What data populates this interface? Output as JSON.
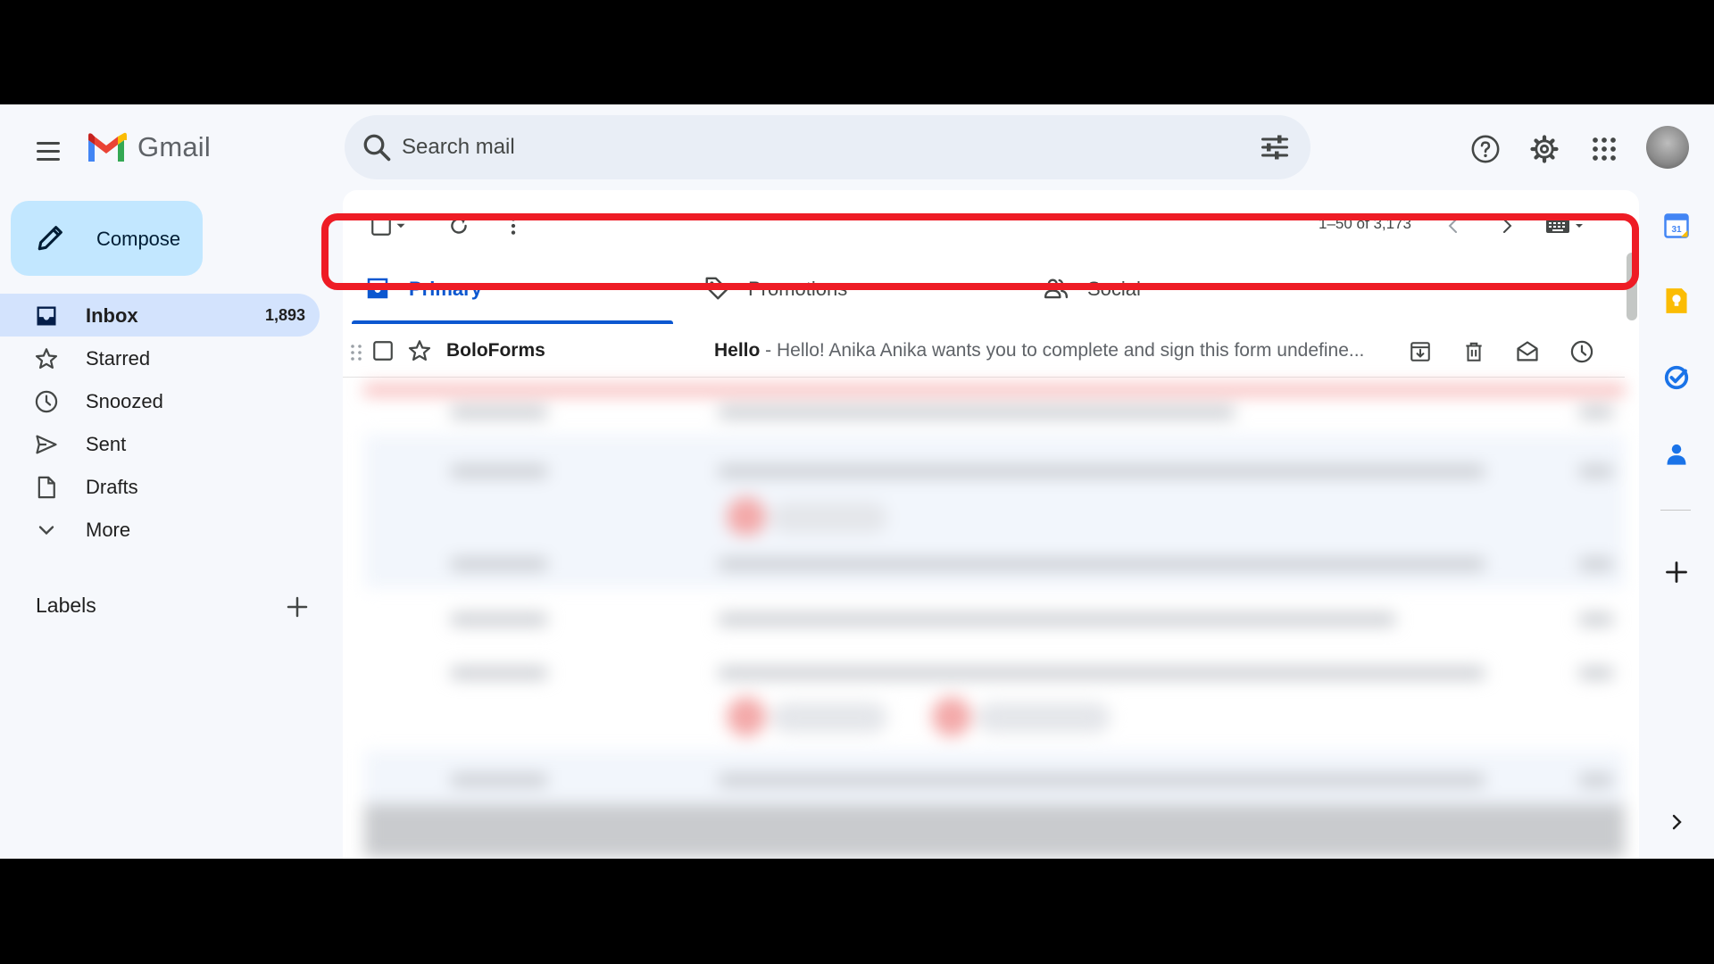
{
  "app": {
    "name": "Gmail"
  },
  "search": {
    "placeholder": "Search mail"
  },
  "compose": {
    "label": "Compose"
  },
  "nav": {
    "items": [
      {
        "label": "Inbox",
        "count": "1,893",
        "icon": "inbox-icon"
      },
      {
        "label": "Starred",
        "count": "",
        "icon": "star-icon"
      },
      {
        "label": "Snoozed",
        "count": "",
        "icon": "clock-icon"
      },
      {
        "label": "Sent",
        "count": "",
        "icon": "send-icon"
      },
      {
        "label": "Drafts",
        "count": "",
        "icon": "draft-icon"
      },
      {
        "label": "More",
        "count": "",
        "icon": "chevron-down-icon"
      }
    ],
    "labels_title": "Labels"
  },
  "toolbar": {
    "pager": "1–50 of 3,173"
  },
  "tabs": [
    {
      "label": "Primary",
      "icon": "inbox-icon",
      "active": true
    },
    {
      "label": "Promotions",
      "icon": "tag-icon",
      "active": false
    },
    {
      "label": "Social",
      "icon": "people-icon",
      "active": false
    }
  ],
  "email": {
    "sender": "BoloForms",
    "subject": "Hello",
    "separator": " - ",
    "snippet": "Hello! Anika Anika wants you to complete and sign this form undefine..."
  },
  "colors": {
    "accent": "#0b57d0",
    "active_nav_bg": "#d3e3fd",
    "compose_bg": "#c2e7ff",
    "highlight": "#ee1c25",
    "background": "#f6f8fc"
  }
}
